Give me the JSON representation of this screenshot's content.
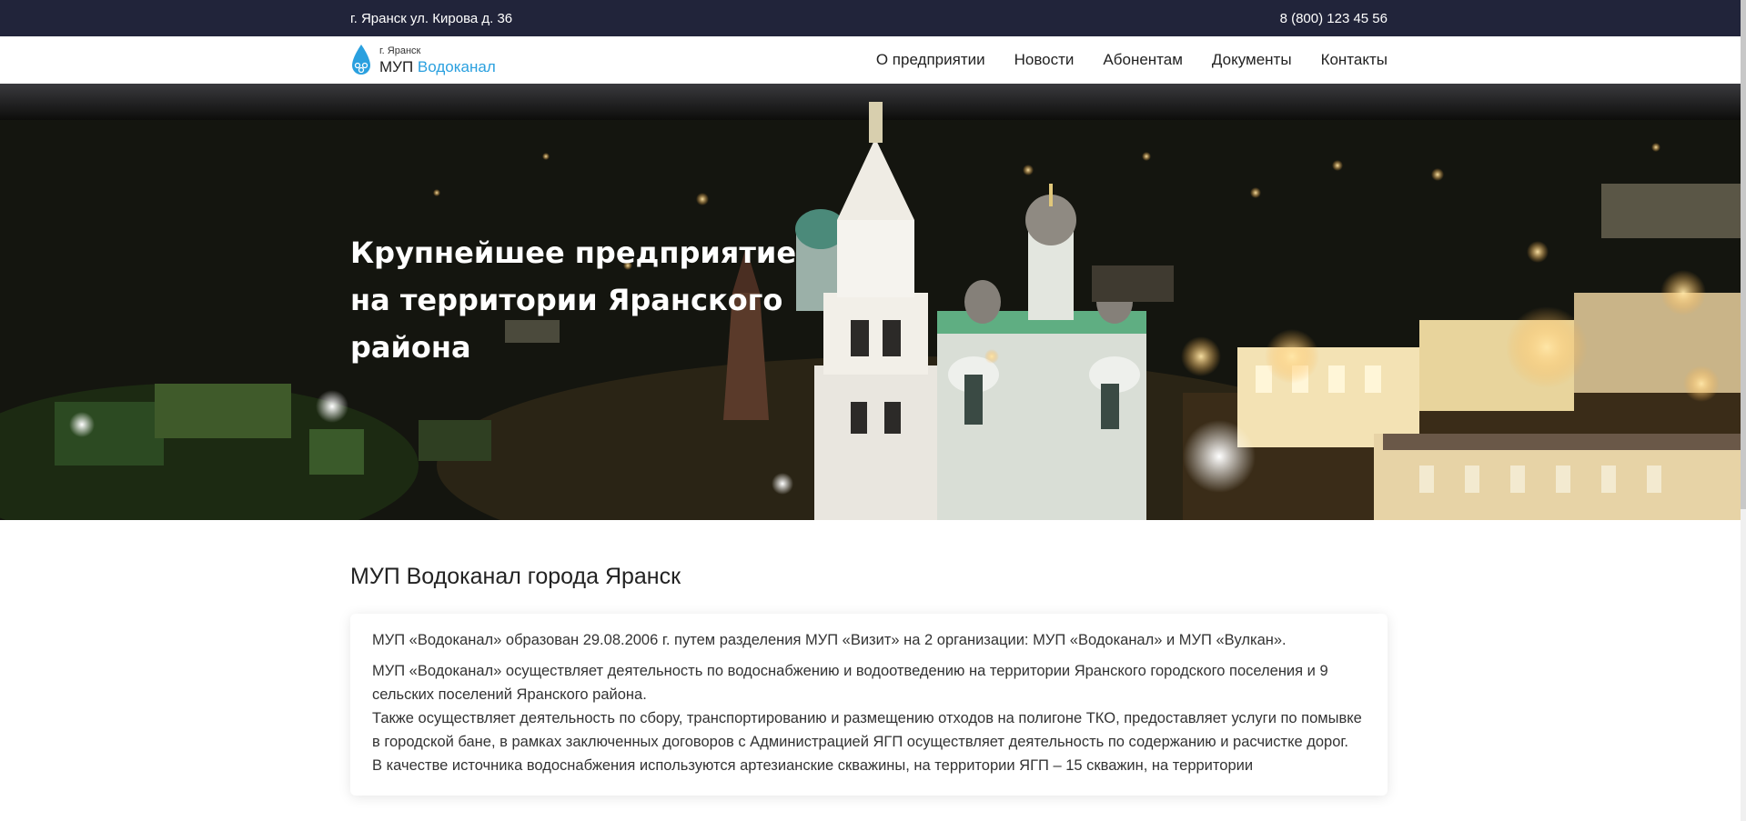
{
  "topbar": {
    "address": "г. Яранск ул. Кирова д. 36",
    "phone": "8 (800) 123 45 56"
  },
  "header": {
    "logo_small": "г. Яранск",
    "logo_main": "МУП",
    "logo_accent": "Водоканал",
    "nav": [
      "О предприятии",
      "Новости",
      "Абонентам",
      "Документы",
      "Контакты"
    ]
  },
  "hero": {
    "title": "Крупнейшее предприятие на территории Яранского района"
  },
  "main": {
    "heading": "МУП Водоканал города Яранск",
    "paragraphs": [
      "МУП «Водоканал» образован 29.08.2006 г. путем разделения МУП «Визит» на 2 организации: МУП «Водоканал» и МУП «Вулкан».",
      "МУП «Водоканал» осуществляет деятельность по водоснабжению и водоотведению на территории Яранского городского поселения и 9 сельских поселений Яранского района.",
      "Также осуществляет деятельность по сбору, транспортированию и размещению отходов на полигоне ТКО, предоставляет услуги по помывке в городской бане, в рамках заключенных договоров с Администрацией ЯГП осуществляет деятельность по содержанию и расчистке дорог.",
      "В качестве источника водоснабжения используются артезианские скважины, на территории ЯГП – 15 скважин, на территории"
    ]
  },
  "colors": {
    "topbar_bg": "#21243a",
    "accent": "#2aa0df"
  },
  "icons": {
    "logo": "water-drop-icon"
  }
}
